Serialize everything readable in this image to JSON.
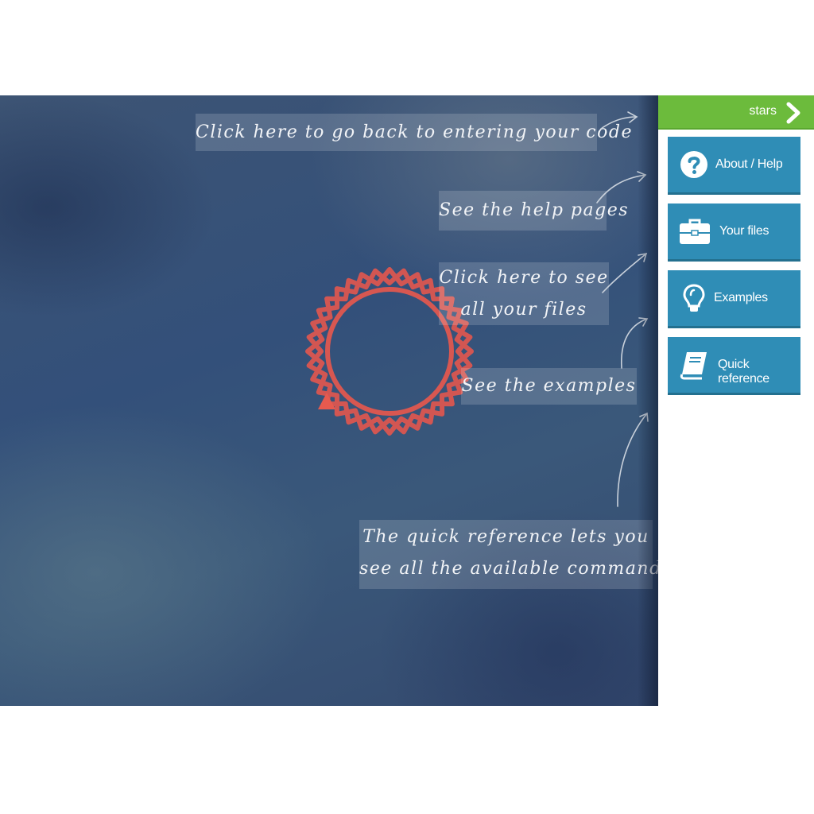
{
  "topbar": {
    "label": "stars",
    "next_icon": "chevron-right-icon",
    "color": "#6cbb3c"
  },
  "sidebar": {
    "buttons": [
      {
        "label": "About / Help",
        "icon": "question-circle-icon"
      },
      {
        "label": "Your files",
        "icon": "briefcase-icon"
      },
      {
        "label": "Examples",
        "icon": "lightbulb-icon"
      },
      {
        "label": "Quick reference",
        "icon": "book-icon"
      }
    ],
    "button_color": "#2f8db6"
  },
  "tips": {
    "back": "Click here to go back to entering your code",
    "help": "See the help pages",
    "files_line1": "Click here to see",
    "files_line2": "all your files",
    "examples": "See the examples",
    "reference_line1": "The quick reference lets you",
    "reference_line2": "see all the available commands"
  },
  "drawing": {
    "shape": "star-ring",
    "stroke_color": "#e0574f"
  }
}
